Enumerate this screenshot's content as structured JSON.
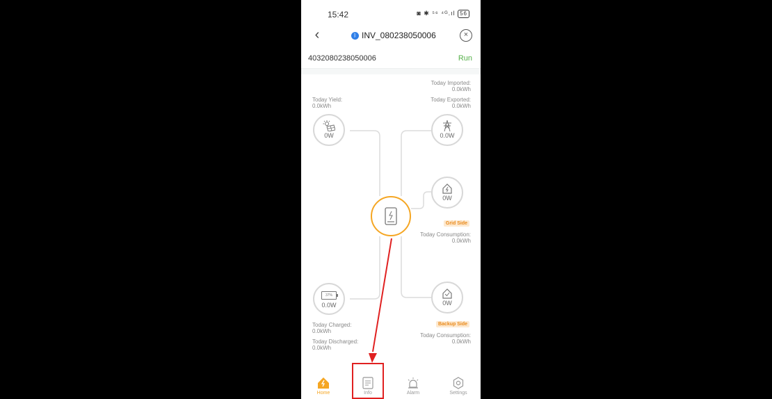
{
  "status_bar": {
    "time": "15:42",
    "icons_text": "◙ ✱ ⁵⁶ ⁴ᴳ.ıl",
    "battery": "56"
  },
  "header": {
    "title": "INV_080238050006"
  },
  "device": {
    "serial": "4032080238050006",
    "status": "Run"
  },
  "solar": {
    "label": "Today Yield:",
    "value": "0.0kWh",
    "power": "0W"
  },
  "grid": {
    "imported_label": "Today Imported:",
    "imported_value": "0.0kWh",
    "exported_label": "Today Exported:",
    "exported_value": "0.0kWh",
    "power": "0.0W"
  },
  "grid_side": {
    "power": "0W",
    "tag": "Grid Side",
    "consumption_label": "Today Consumption:",
    "consumption_value": "0.0kWh"
  },
  "battery": {
    "soc": "37%",
    "power": "0.0W",
    "charged_label": "Today Charged:",
    "charged_value": "0.0kWh",
    "discharged_label": "Today Discharged:",
    "discharged_value": "0.0kWh"
  },
  "backup_side": {
    "power": "0W",
    "tag": "Backup Side",
    "consumption_label": "Today Consumption:",
    "consumption_value": "0.0kWh"
  },
  "tabs": [
    {
      "label": "Home",
      "icon": "home-icon"
    },
    {
      "label": "Info",
      "icon": "info-list-icon"
    },
    {
      "label": "Alarm",
      "icon": "alarm-icon"
    },
    {
      "label": "Settings",
      "icon": "gear-icon"
    }
  ],
  "colors": {
    "accent": "#f5a623",
    "run": "#55b049",
    "highlight": "#e02020",
    "bluetooth": "#2f7fe8"
  }
}
